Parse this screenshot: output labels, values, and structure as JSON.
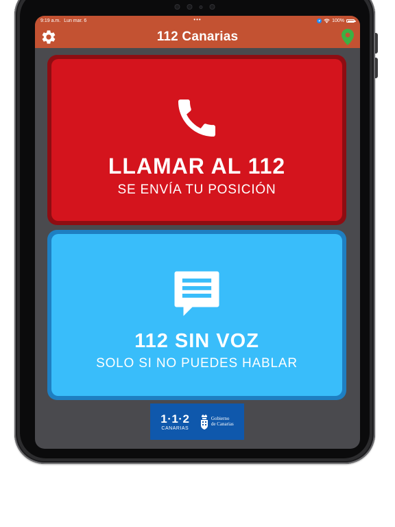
{
  "status_bar": {
    "time": "9:19 a.m.",
    "date": "Lun mar. 6",
    "center_dots": "•••",
    "battery": "100%"
  },
  "nav": {
    "title": "112 Canarias",
    "left_icon": "gear-icon",
    "right_icon": "location-pin-icon"
  },
  "call_button": {
    "title": "LLAMAR AL 112",
    "subtitle": "SE ENVÍA TU POSICIÓN",
    "icon": "phone-icon"
  },
  "text_button": {
    "title": "112 SIN VOZ",
    "subtitle": "SOLO SI NO PUEDES HABLAR",
    "icon": "chat-bubble-icon"
  },
  "footer": {
    "logo_112_number": "1·1·2",
    "logo_112_sub": "CANARIAS",
    "gov_line1": "Gobierno",
    "gov_line2": "de Canarias"
  },
  "colors": {
    "header": "#c35232",
    "call_button": "#d4141d",
    "call_button_border": "#8e0d12",
    "text_button": "#39bdfa",
    "text_button_border": "#1e7fc2",
    "background": "#4a4a4e",
    "logo_background": "#0f58ac",
    "pin": "#3cb043"
  }
}
